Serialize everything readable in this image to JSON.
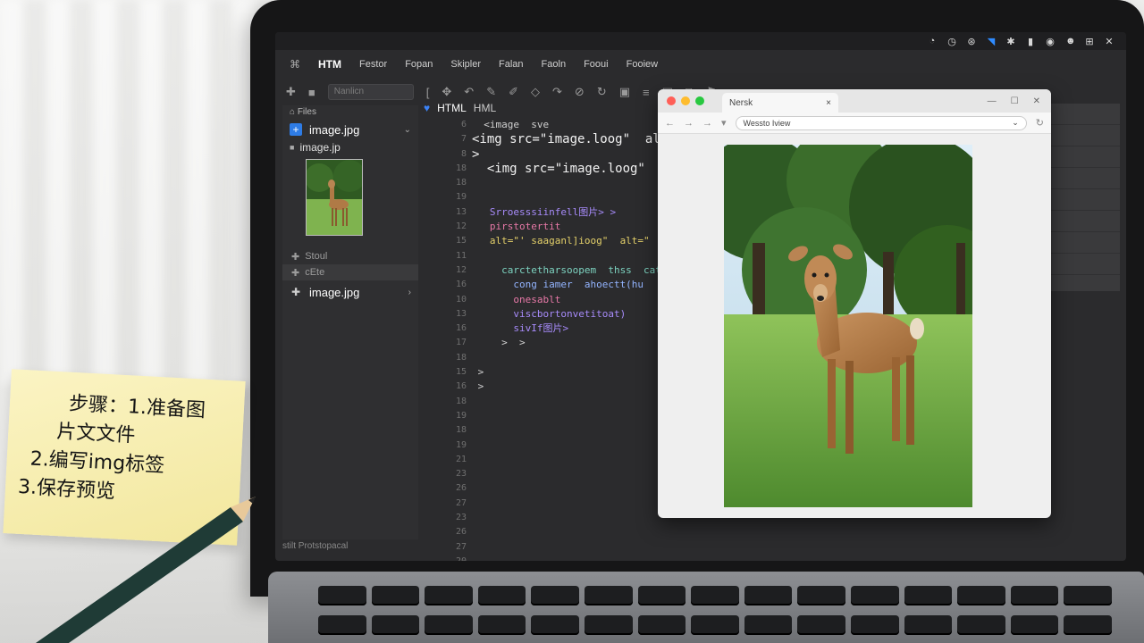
{
  "system_bar": {
    "icons": [
      "timer-icon",
      "clock-icon",
      "network-icon",
      "wifi-icon",
      "bluetooth-icon",
      "battery-icon",
      "volume-icon",
      "user-icon",
      "grid-icon",
      "close-icon"
    ]
  },
  "menu": {
    "app_name": "HTM",
    "items": [
      "Festor",
      "Fopan",
      "Skipler",
      "Falan",
      "Faoln",
      "Fooui",
      "Fooiew"
    ]
  },
  "toolbar": {
    "search_placeholder": "Nanlicn"
  },
  "file_panel": {
    "header": "Files",
    "items": [
      {
        "label": "image.jpg",
        "expanded": true
      },
      {
        "label": "image.jp"
      }
    ],
    "gray_items": [
      "Stoul",
      "cEte"
    ],
    "second_file": "image.jpg",
    "footer": "stilt   Protstopacal"
  },
  "editor": {
    "tab_label": "HTML",
    "tab_label_2": "HML",
    "line_numbers": [
      "",
      "6",
      "7",
      "8",
      "",
      "18",
      "18",
      "19",
      "13",
      "12",
      "15",
      "11",
      "12",
      "16",
      "10",
      "13",
      "16",
      "17",
      "18",
      "15",
      "16",
      "18",
      "19",
      "18",
      "19",
      "21",
      "23",
      "26",
      "27",
      "23",
      "26",
      "27",
      "20"
    ],
    "lines": [
      {
        "text": "  <image  sve",
        "style": ""
      },
      {
        "text": "<img src=\"image.loog\"  alt=\"",
        "style": "big"
      },
      {
        "text": ">",
        "style": "big"
      },
      {
        "text": "  <img src=\"image.loog\"  alt=\"",
        "style": "big"
      },
      {
        "text": "",
        "style": ""
      },
      {
        "text": "",
        "style": ""
      },
      {
        "text": "   Srroesssiinfell图片> >",
        "style": "purple"
      },
      {
        "text": "   pirstotertit",
        "style": "pink"
      },
      {
        "text": "   alt=\"' saaganl]ioog\"  alt=\"",
        "style": "yellow"
      },
      {
        "text": "",
        "style": ""
      },
      {
        "text": "     carctetharsoopem  thss  cat",
        "style": "teal"
      },
      {
        "text": "       cong iamer  ahoectt(hu",
        "style": "blue"
      },
      {
        "text": "       onesablt",
        "style": "pink"
      },
      {
        "text": "       viscbortonvetitoat)",
        "style": "purple"
      },
      {
        "text": "       sivIf图片>",
        "style": "purple"
      },
      {
        "text": "     >  >",
        "style": ""
      },
      {
        "text": "",
        "style": ""
      },
      {
        "text": " >",
        "style": ""
      },
      {
        "text": " >",
        "style": ""
      }
    ]
  },
  "browser": {
    "tab_title": "Nersk",
    "tab_close": "×",
    "address": "Wessto Iview",
    "nav": [
      "←",
      "→",
      "→",
      "▾"
    ],
    "window_controls": [
      "—",
      "☐",
      "✕"
    ],
    "colors": {
      "close": "#ff5f57",
      "minimize": "#febc2e",
      "zoom": "#28c840"
    }
  },
  "sticky_note": {
    "lines": [
      "步骤：1.准备图",
      "片文文件",
      "2.编写img标签",
      "3.保存预览"
    ]
  }
}
